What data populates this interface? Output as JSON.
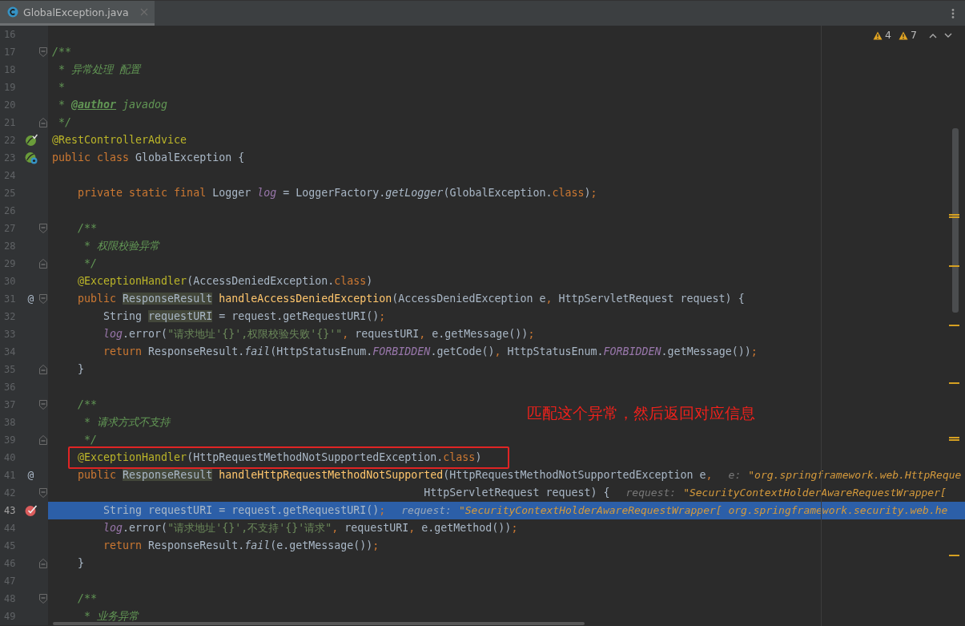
{
  "tabs": [
    {
      "label": "GlobalException.java",
      "selected": true
    }
  ],
  "inspections": [
    {
      "count": "4"
    },
    {
      "count": "7"
    }
  ],
  "lines": [
    {
      "number": "16"
    },
    {
      "number": "17",
      "fold_marker": {
        "kind": "start"
      },
      "tokens": [
        {
          "text": "/**",
          "kind": "comment"
        }
      ]
    },
    {
      "number": "18",
      "tokens": [
        {
          "text": " * 异常处理 配置",
          "kind": "comment"
        }
      ]
    },
    {
      "number": "19",
      "tokens": [
        {
          "text": " *",
          "kind": "comment"
        }
      ]
    },
    {
      "number": "20",
      "tokens": [
        {
          "text": " * ",
          "kind": "comment"
        },
        {
          "text": "@author",
          "kind": "doctag"
        },
        {
          "text": " javadog",
          "kind": "comment"
        }
      ]
    },
    {
      "number": "21",
      "fold_marker": {
        "kind": "end"
      },
      "tokens": [
        {
          "text": " */",
          "kind": "comment"
        }
      ]
    },
    {
      "number": "22",
      "gutter": {
        "kind": "leaf-check"
      },
      "tokens": [
        {
          "text": "@RestControllerAdvice",
          "kind": "annotation"
        }
      ]
    },
    {
      "number": "23",
      "gutter": {
        "kind": "leaf-badge"
      },
      "tokens": [
        {
          "text": "public class ",
          "kind": "keyword"
        },
        {
          "text": "GlobalException {",
          "kind": "plain"
        }
      ]
    },
    {
      "number": "24"
    },
    {
      "number": "25",
      "tokens": [
        {
          "text": "    private static final ",
          "kind": "keyword"
        },
        {
          "text": "Logger ",
          "kind": "plain"
        },
        {
          "text": "log",
          "kind": "field"
        },
        {
          "text": " = LoggerFactory.",
          "kind": "plain"
        },
        {
          "text": "getLogger",
          "kind": "static-call"
        },
        {
          "text": "(GlobalException.",
          "kind": "plain"
        },
        {
          "text": "class",
          "kind": "keyword"
        },
        {
          "text": ")",
          "kind": "plain"
        },
        {
          "text": ";",
          "kind": "keyword"
        }
      ]
    },
    {
      "number": "26"
    },
    {
      "number": "27",
      "fold_marker": {
        "kind": "start"
      },
      "tokens": [
        {
          "text": "    /**",
          "kind": "comment"
        }
      ]
    },
    {
      "number": "28",
      "tokens": [
        {
          "text": "     * 权限校验异常",
          "kind": "comment"
        }
      ]
    },
    {
      "number": "29",
      "fold_marker": {
        "kind": "end"
      },
      "tokens": [
        {
          "text": "     */",
          "kind": "comment"
        }
      ]
    },
    {
      "number": "30",
      "tokens": [
        {
          "text": "    @ExceptionHandler",
          "kind": "annotation"
        },
        {
          "text": "(AccessDeniedException.",
          "kind": "plain"
        },
        {
          "text": "class",
          "kind": "keyword"
        },
        {
          "text": ")",
          "kind": "plain"
        }
      ]
    },
    {
      "number": "31",
      "fold_marker": {
        "kind": "start"
      },
      "gutter": {
        "kind": "text",
        "text": "@"
      },
      "tokens": [
        {
          "text": "    public ",
          "kind": "keyword"
        },
        {
          "text": "ResponseResult",
          "kind": "usage"
        },
        {
          "text": " handleAccessDeniedException",
          "kind": "declaration"
        },
        {
          "text": "(AccessDeniedException e",
          "kind": "plain"
        },
        {
          "text": ",",
          "kind": "keyword"
        },
        {
          "text": " HttpServletRequest request) {",
          "kind": "plain"
        }
      ]
    },
    {
      "number": "32",
      "tokens": [
        {
          "text": "        String ",
          "kind": "plain"
        },
        {
          "text": "requestURI",
          "kind": "usage"
        },
        {
          "text": " = request.getRequestURI()",
          "kind": "plain"
        },
        {
          "text": ";",
          "kind": "keyword"
        }
      ]
    },
    {
      "number": "33",
      "tokens": [
        {
          "text": "        log",
          "kind": "field"
        },
        {
          "text": ".error(",
          "kind": "plain"
        },
        {
          "text": "\"请求地址'{}',权限校验失败'{}'\"",
          "kind": "string"
        },
        {
          "text": ",",
          "kind": "keyword"
        },
        {
          "text": " requestURI",
          "kind": "plain"
        },
        {
          "text": ",",
          "kind": "keyword"
        },
        {
          "text": " e.getMessage())",
          "kind": "plain"
        },
        {
          "text": ";",
          "kind": "keyword"
        }
      ]
    },
    {
      "number": "34",
      "tokens": [
        {
          "text": "        return ",
          "kind": "keyword"
        },
        {
          "text": "ResponseResult.",
          "kind": "plain"
        },
        {
          "text": "fail",
          "kind": "static-call"
        },
        {
          "text": "(HttpStatusEnum.",
          "kind": "plain"
        },
        {
          "text": "FORBIDDEN",
          "kind": "field"
        },
        {
          "text": ".getCode()",
          "kind": "plain"
        },
        {
          "text": ",",
          "kind": "keyword"
        },
        {
          "text": " HttpStatusEnum.",
          "kind": "plain"
        },
        {
          "text": "FORBIDDEN",
          "kind": "field"
        },
        {
          "text": ".getMessage())",
          "kind": "plain"
        },
        {
          "text": ";",
          "kind": "keyword"
        }
      ]
    },
    {
      "number": "35",
      "fold_marker": {
        "kind": "end"
      },
      "tokens": [
        {
          "text": "    }",
          "kind": "plain"
        }
      ]
    },
    {
      "number": "36"
    },
    {
      "number": "37",
      "fold_marker": {
        "kind": "start"
      },
      "tokens": [
        {
          "text": "    /**",
          "kind": "comment"
        }
      ]
    },
    {
      "number": "38",
      "tokens": [
        {
          "text": "     * 请求方式不支持",
          "kind": "comment"
        }
      ]
    },
    {
      "number": "39",
      "fold_marker": {
        "kind": "end"
      },
      "tokens": [
        {
          "text": "     */",
          "kind": "comment"
        }
      ]
    },
    {
      "number": "40",
      "boxed": true,
      "tokens": [
        {
          "text": "    @ExceptionHandler",
          "kind": "annotation"
        },
        {
          "text": "(HttpRequestMethodNotSupportedException.",
          "kind": "plain"
        },
        {
          "text": "class",
          "kind": "keyword"
        },
        {
          "text": ")",
          "kind": "plain"
        }
      ]
    },
    {
      "number": "41",
      "gutter": {
        "kind": "text",
        "text": "@"
      },
      "tokens": [
        {
          "text": "    public ",
          "kind": "keyword"
        },
        {
          "text": "ResponseResult",
          "kind": "usage"
        },
        {
          "text": " handleHttpRequestMethodNotSupported",
          "kind": "declaration"
        },
        {
          "text": "(HttpRequestMethodNotSupportedException e",
          "kind": "plain"
        },
        {
          "text": ",",
          "kind": "keyword"
        }
      ],
      "hint": {
        "label": "e:",
        "value": "\"org.springframework.web.HttpReque"
      }
    },
    {
      "number": "42",
      "fold_marker": {
        "kind": "start"
      },
      "tokens": [
        {
          "text": "                                                          HttpServletRequest request) {",
          "kind": "plain"
        }
      ],
      "hint": {
        "label": "request:",
        "value": "\"SecurityContextHolderAwareRequestWrapper["
      }
    },
    {
      "number": "43",
      "current": true,
      "gutter": {
        "kind": "breakpoint"
      },
      "tokens": [
        {
          "text": "        String requestURI = request.getRequestURI()",
          "kind": "plain"
        },
        {
          "text": ";",
          "kind": "keyword"
        }
      ],
      "hint": {
        "label": "request:",
        "value": "\"SecurityContextHolderAwareRequestWrapper[ org.springframework.security.web.he"
      }
    },
    {
      "number": "44",
      "tokens": [
        {
          "text": "        log",
          "kind": "field"
        },
        {
          "text": ".error(",
          "kind": "plain"
        },
        {
          "text": "\"请求地址'{}',不支持'{}'请求\"",
          "kind": "string"
        },
        {
          "text": ",",
          "kind": "keyword"
        },
        {
          "text": " requestURI",
          "kind": "plain"
        },
        {
          "text": ",",
          "kind": "keyword"
        },
        {
          "text": " e.getMethod())",
          "kind": "plain"
        },
        {
          "text": ";",
          "kind": "keyword"
        }
      ]
    },
    {
      "number": "45",
      "tokens": [
        {
          "text": "        return ",
          "kind": "keyword"
        },
        {
          "text": "ResponseResult.",
          "kind": "plain"
        },
        {
          "text": "fail",
          "kind": "static-call"
        },
        {
          "text": "(e.getMessage())",
          "kind": "plain"
        },
        {
          "text": ";",
          "kind": "keyword"
        }
      ]
    },
    {
      "number": "46",
      "fold_marker": {
        "kind": "end"
      },
      "tokens": [
        {
          "text": "    }",
          "kind": "plain"
        }
      ]
    },
    {
      "number": "47"
    },
    {
      "number": "48",
      "fold_marker": {
        "kind": "start"
      },
      "tokens": [
        {
          "text": "    /**",
          "kind": "comment"
        }
      ]
    },
    {
      "number": "49",
      "tokens": [
        {
          "text": "     * 业务异常",
          "kind": "comment"
        }
      ]
    }
  ],
  "callout": {
    "text": "匹配这个异常，然后返回对应信息"
  }
}
